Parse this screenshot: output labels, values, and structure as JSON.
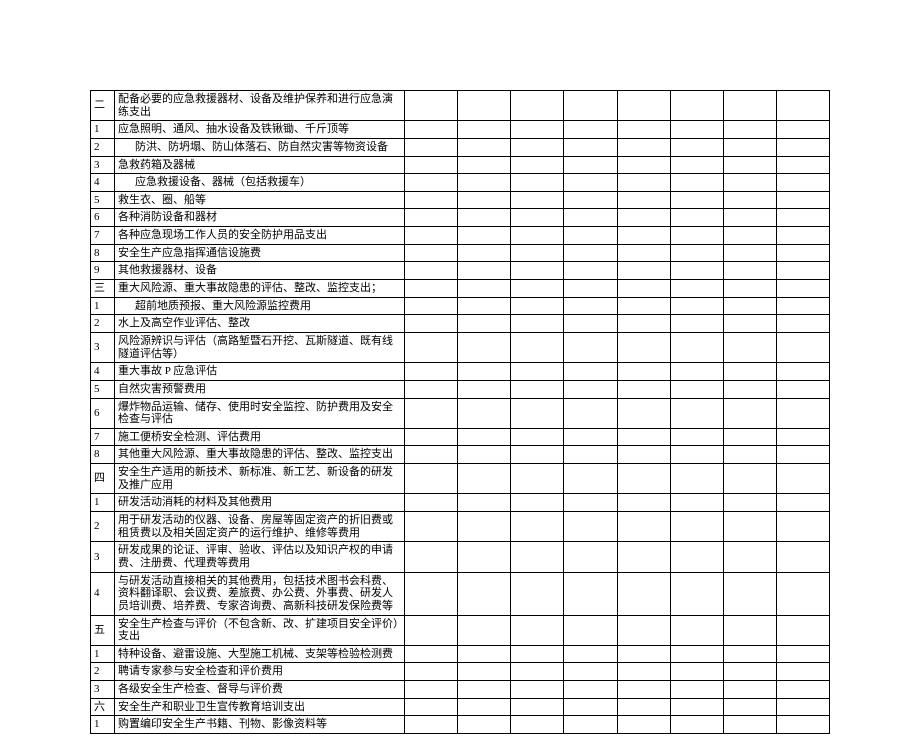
{
  "rows": [
    {
      "num": "二",
      "desc": "配备必要的应急救援器材、设备及维护保养和进行应急演练支出",
      "indent": 0
    },
    {
      "num": "1",
      "desc": "应急照明、通风、抽水设备及铁锹锄、千斤顶等",
      "indent": 0
    },
    {
      "num": "2",
      "desc": "防洪、防坍塌、防山体落石、防自然灾害等物资设备",
      "indent": 1
    },
    {
      "num": "3",
      "desc": "急救药箱及器械",
      "indent": 0
    },
    {
      "num": "4",
      "desc": "应急救援设备、器械（包括救援车）",
      "indent": 1
    },
    {
      "num": "5",
      "desc": "救生衣、圈、船等",
      "indent": 0
    },
    {
      "num": "6",
      "desc": "各种消防设备和器材",
      "indent": 0
    },
    {
      "num": "7",
      "desc": "各种应急现场工作人员的安全防护用品支出",
      "indent": 0
    },
    {
      "num": "8",
      "desc": "安全生产应急指挥通信设施费",
      "indent": 0
    },
    {
      "num": "9",
      "desc": "其他救援器材、设备",
      "indent": 0
    },
    {
      "num": "三",
      "desc": "重大风险源、重大事故隐患的评估、整改、监控支出；",
      "indent": 0
    },
    {
      "num": "1",
      "desc": "超前地质预报、重大风险源监控费用",
      "indent": 1
    },
    {
      "num": "2",
      "desc": "水上及高空作业评估、整改",
      "indent": 0
    },
    {
      "num": "3",
      "desc": "风险源辨识与评估（高路堑暨石开挖、瓦斯隧道、既有线隧道评估等）",
      "indent": 0
    },
    {
      "num": "4",
      "desc": "重大事故 P 应急评估",
      "indent": 0
    },
    {
      "num": "5",
      "desc": "自然灾害预警费用",
      "indent": 0
    },
    {
      "num": "6",
      "desc": "爆炸物品运输、储存、使用时安全监控、防护费用及安全检查与评估",
      "indent": 0
    },
    {
      "num": "7",
      "desc": "施工便桥安全检测、评估费用",
      "indent": 0
    },
    {
      "num": "8",
      "desc": "其他重大风险源、重大事故隐患的评估、整改、监控支出",
      "indent": 0
    },
    {
      "num": "四",
      "desc": "安全生产适用的新技术、新标准、新工艺、新设备的研发及推广应用",
      "indent": 0
    },
    {
      "num": "1",
      "desc": "研发活动消耗的材料及其他费用",
      "indent": 0
    },
    {
      "num": "2",
      "desc": "用于研发活动的仪器、设备、房屋等固定资产的折旧费或租赁费以及相关固定资产的运行维护、维修等费用",
      "indent": 0
    },
    {
      "num": "3",
      "desc": "研发成果的论证、评审、验收、评估以及知识产权的申请费、注册费、代理费等费用",
      "indent": 0
    },
    {
      "num": "4",
      "desc": "与研发活动直接相关的其他费用，包括技术图书会科费、资料翻译职、会议费、差旅费、办公费、外事费、研发人员培训费、培养费、专家咨询费、高新科技研发保险费等",
      "indent": 0
    },
    {
      "num": "五",
      "desc": "安全生产检查与评价（不包含新、改、扩建项目安全评价）支出",
      "indent": 0
    },
    {
      "num": "1",
      "desc": "特种设备、避雷设施、大型施工机械、支架等检验检测费",
      "indent": 0
    },
    {
      "num": "2",
      "desc": "聘请专家参与安全检查和评价费用",
      "indent": 0
    },
    {
      "num": "3",
      "desc": "各级安全生产检查、督导与评价费",
      "indent": 0
    },
    {
      "num": "六",
      "desc": "安全生产和职业卫生宣传教育培训支出",
      "indent": 0
    },
    {
      "num": "1",
      "desc": "购置编印安全生产书籍、刊物、影像资料等",
      "indent": 0
    }
  ]
}
